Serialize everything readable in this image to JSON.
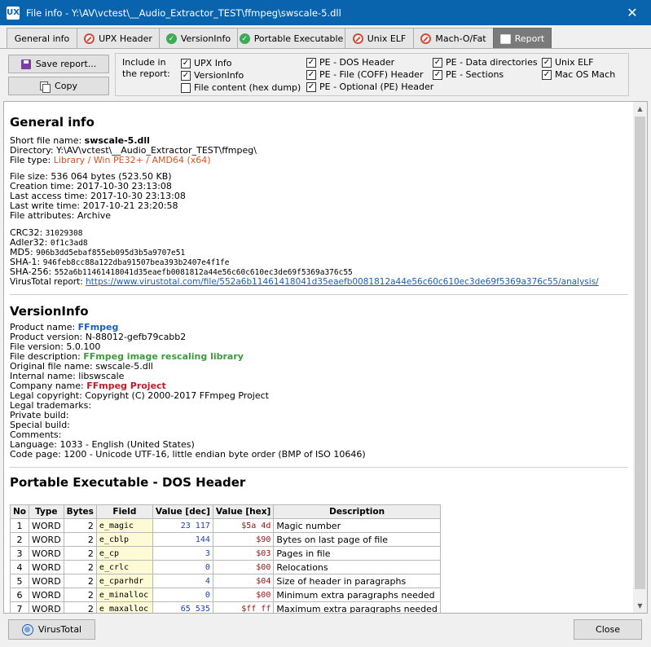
{
  "window": {
    "app_icon": "UX",
    "title": "File info - Y:\\AV\\vctest\\__Audio_Extractor_TEST\\ffmpeg\\swscale-5.dll",
    "close_glyph": "✕"
  },
  "tabs": [
    {
      "label": "General info",
      "icon": ""
    },
    {
      "label": "UPX Header",
      "icon": "no-entry-icon"
    },
    {
      "label": "VersionInfo",
      "icon": "check-icon"
    },
    {
      "label": "Portable Executable",
      "icon": "check-icon"
    },
    {
      "label": "Unix ELF",
      "icon": "no-entry-icon"
    },
    {
      "label": "Mach-O/Fat",
      "icon": "no-entry-icon"
    },
    {
      "label": "Report",
      "icon": "report-icon"
    }
  ],
  "toolbar": {
    "save_label": "Save report...",
    "copy_label": "Copy"
  },
  "include": {
    "label_line1": "Include in",
    "label_line2": "the report:",
    "options": [
      {
        "label": "UPX Info",
        "checked": true
      },
      {
        "label": "VersionInfo",
        "checked": true
      },
      {
        "label": "File content (hex dump)",
        "checked": false
      },
      {
        "label": "PE - DOS Header",
        "checked": true
      },
      {
        "label": "PE - File (COFF) Header",
        "checked": true
      },
      {
        "label": "PE - Optional (PE) Header",
        "checked": true
      },
      {
        "label": "PE - Data directories",
        "checked": true
      },
      {
        "label": "PE - Sections",
        "checked": true
      },
      {
        "label": "Unix ELF",
        "checked": true
      },
      {
        "label": "Mac OS Mach",
        "checked": true
      }
    ]
  },
  "general": {
    "heading": "General info",
    "short_name_label": "Short file name:",
    "short_name": "swscale-5.dll",
    "directory": "Directory: Y:\\AV\\vctest\\__Audio_Extractor_TEST\\ffmpeg\\",
    "file_type_label": "File type:",
    "file_type": "Library / Win PE32+ / AMD64 (x64)",
    "file_size": "File size: 536 064 bytes (523.50 KB)",
    "creation": "Creation time: 2017-10-30 23:13:08",
    "last_access": "Last access time: 2017-10-30 23:13:08",
    "last_write": "Last write time: 2017-10-21 23:20:58",
    "attributes": "File attributes: Archive",
    "crc32_label": "CRC32:",
    "crc32": "31029308",
    "adler32_label": "Adler32:",
    "adler32": "0f1c3ad8",
    "md5_label": "MD5:",
    "md5": "906b3dd5ebaf855eb095d3b5a9707e51",
    "sha1_label": "SHA-1:",
    "sha1": "946feb8cc88a122dba91507bea393b2407e4f1fe",
    "sha256_label": "SHA-256:",
    "sha256": "552a6b11461418041d35eaefb0081812a44e56c60c610ec3de69f5369a376c55",
    "virustotal_label": "VirusTotal report:",
    "virustotal_url": "https://www.virustotal.com/file/552a6b11461418041d35eaefb0081812a44e56c60c610ec3de69f5369a376c55/analysis/"
  },
  "versioninfo": {
    "heading": "VersionInfo",
    "product_name_label": "Product name:",
    "product_name": "FFmpeg",
    "product_version": "Product version: N-88012-gefb79cabb2",
    "file_version": "File version: 5.0.100",
    "file_description_label": "File description:",
    "file_description": "FFmpeg image rescaling library",
    "original_name": "Original file name: swscale-5.dll",
    "internal_name": "Internal name: libswscale",
    "company_label": "Company name:",
    "company": "FFmpeg Project",
    "copyright": "Legal copyright: Copyright (C) 2000-2017 FFmpeg Project",
    "trademarks": "Legal trademarks:",
    "private_build": "Private build:",
    "special_build": "Special build:",
    "comments": "Comments:",
    "language": "Language: 1033 - English (United States)",
    "code_page": "Code page: 1200 - Unicode UTF-16, little endian byte order (BMP of ISO 10646)"
  },
  "dos_header": {
    "heading": "Portable Executable - DOS Header",
    "columns": [
      "No",
      "Type",
      "Bytes",
      "Field",
      "Value [dec]",
      "Value [hex]",
      "Description"
    ],
    "rows": [
      {
        "no": "1",
        "type": "WORD",
        "bytes": "2",
        "field": "e_magic",
        "dec": "23 117",
        "hex": "$5a 4d",
        "desc": "Magic number"
      },
      {
        "no": "2",
        "type": "WORD",
        "bytes": "2",
        "field": "e_cblp",
        "dec": "144",
        "hex": "$90",
        "desc": "Bytes on last page of file"
      },
      {
        "no": "3",
        "type": "WORD",
        "bytes": "2",
        "field": "e_cp",
        "dec": "3",
        "hex": "$03",
        "desc": "Pages in file"
      },
      {
        "no": "4",
        "type": "WORD",
        "bytes": "2",
        "field": "e_crlc",
        "dec": "0",
        "hex": "$00",
        "desc": "Relocations"
      },
      {
        "no": "5",
        "type": "WORD",
        "bytes": "2",
        "field": "e_cparhdr",
        "dec": "4",
        "hex": "$04",
        "desc": "Size of header in paragraphs"
      },
      {
        "no": "6",
        "type": "WORD",
        "bytes": "2",
        "field": "e_minalloc",
        "dec": "0",
        "hex": "$00",
        "desc": "Minimum extra paragraphs needed"
      },
      {
        "no": "7",
        "type": "WORD",
        "bytes": "2",
        "field": "e_maxalloc",
        "dec": "65 535",
        "hex": "$ff ff",
        "desc": "Maximum extra paragraphs needed"
      }
    ]
  },
  "footer": {
    "virustotal_label": "VirusTotal",
    "close_label": "Close"
  }
}
